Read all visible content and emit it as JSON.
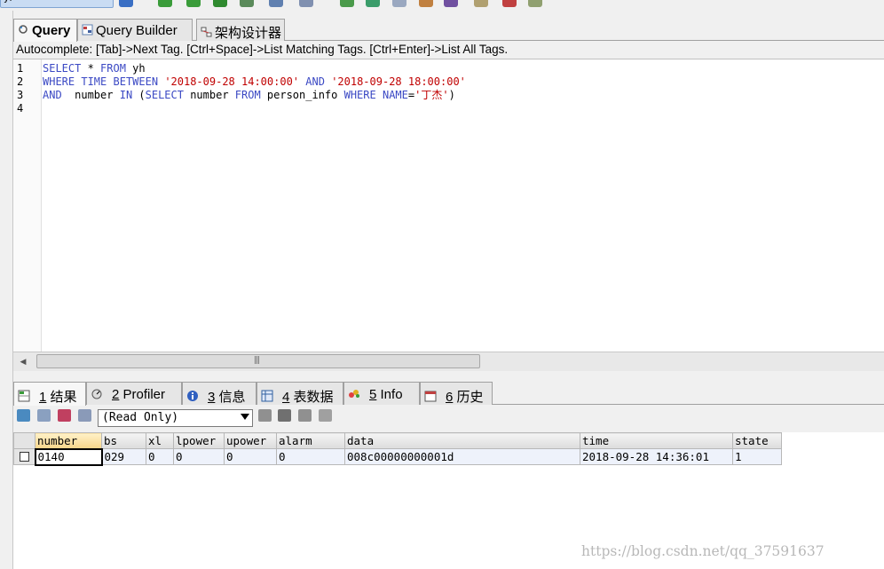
{
  "toolbar": {
    "database_combo": "yl",
    "icons": [
      "query-icon",
      "run-icon",
      "run-selected-icon",
      "refresh-icon",
      "export-icon",
      "grid-icon",
      "settings-icon"
    ]
  },
  "query_tabs": [
    {
      "label": "Query",
      "icon": "query-icon",
      "active": true
    },
    {
      "label": "Query Builder",
      "icon": "query-builder-icon",
      "active": false
    },
    {
      "label": "架构设计器",
      "icon": "schema-designer-icon",
      "active": false
    }
  ],
  "autocomplete_hint": "Autocomplete: [Tab]->Next Tag. [Ctrl+Space]->List Matching Tags. [Ctrl+Enter]->List All Tags.",
  "editor": {
    "line_numbers": [
      "1",
      "2",
      "3",
      "4"
    ],
    "line1": {
      "k1": "SELECT",
      "p1": " * ",
      "k2": "FROM",
      "p2": " yh"
    },
    "line2": {
      "k1": "WHERE",
      "p1": " ",
      "k2": "TIME",
      "p2": " ",
      "k3": "BETWEEN",
      "p3": " ",
      "s1": "'2018-09-28 14:00:00'",
      "p4": " ",
      "k4": "AND",
      "p5": " ",
      "s2": "'2018-09-28 18:00:00'"
    },
    "line3": {
      "k1": "AND",
      "p1": "  number ",
      "k2": "IN",
      "p2": " (",
      "k3": "SELECT",
      "p3": " number ",
      "k4": "FROM",
      "p4": " person_info ",
      "k5": "WHERE",
      "p5": " ",
      "k6": "NAME",
      "p6": "=",
      "s1": "'丁杰'",
      "p7": ")"
    }
  },
  "result_tabs": [
    {
      "num": "1",
      "label": " 结果",
      "icon": "result-icon",
      "active": true
    },
    {
      "num": "2",
      "label": " Profiler",
      "icon": "profiler-icon",
      "active": false
    },
    {
      "num": "3",
      "label": " 信息",
      "icon": "info-icon",
      "active": false
    },
    {
      "num": "4",
      "label": " 表数据",
      "icon": "table-data-icon",
      "active": false
    },
    {
      "num": "5",
      "label": " Info",
      "icon": "chart-info-icon",
      "active": false
    },
    {
      "num": "6",
      "label": " 历史",
      "icon": "history-icon",
      "active": false
    }
  ],
  "result_toolbar": {
    "mode_select": "(Read Only)"
  },
  "grid": {
    "columns": [
      "number",
      "bs",
      "xl",
      "lpower",
      "upower",
      "alarm",
      "data",
      "time",
      "state"
    ],
    "rows": [
      [
        "0140",
        "029",
        "0",
        "0",
        "0",
        "0",
        "008c00000000001d",
        "2018-09-28 14:36:01",
        "1"
      ]
    ]
  },
  "watermark": "https://blog.csdn.net/qq_37591637",
  "colors": {
    "keyword": "#3b49c4",
    "string": "#c00000",
    "selected_header": "#f7d58a",
    "row_bg": "#eef2fb"
  }
}
